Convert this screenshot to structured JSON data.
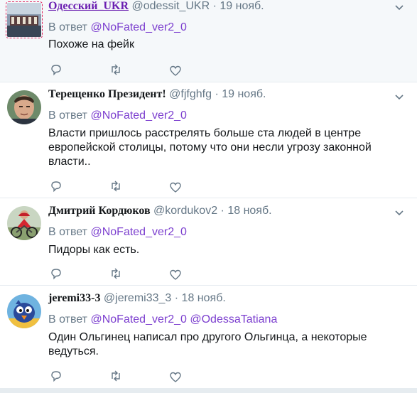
{
  "tweets": [
    {
      "name": "Одесский_UKR",
      "handle": "@odessit_UKR",
      "dot": "·",
      "date": "19 нояб.",
      "reply_prefix": "В ответ",
      "reply_mentions": [
        "@NoFated_ver2_0"
      ],
      "text": "Похоже на фейк",
      "avatar": "odessa-city-avatar"
    },
    {
      "name": "Терещенко Президент!",
      "handle": "@fjfghfg",
      "dot": "·",
      "date": "19 нояб.",
      "reply_prefix": "В ответ",
      "reply_mentions": [
        "@NoFated_ver2_0"
      ],
      "text": "Власти пришлось расстрелять больше ста людей в центре европейской столицы, потому что они несли угрозу законной власти..",
      "avatar": "man-portrait-avatar"
    },
    {
      "name": "Дмитрий Кордюков",
      "handle": "@kordukov2",
      "dot": "·",
      "date": "18 нояб.",
      "reply_prefix": "В ответ",
      "reply_mentions": [
        "@NoFated_ver2_0"
      ],
      "text": "Пидоры как есть.",
      "avatar": "cyclist-avatar"
    },
    {
      "name": "jeremi33-3",
      "handle": "@jeremi33_3",
      "dot": "·",
      "date": "18 нояб.",
      "reply_prefix": "В ответ",
      "reply_mentions": [
        "@NoFated_ver2_0",
        "@OdessaTatiana"
      ],
      "text": "Один Ольгинец написал про другого Ольгинца, а некоторые ведуться.",
      "avatar": "cartoon-bird-avatar"
    }
  ],
  "icons": {
    "reply": "reply-icon",
    "retweet": "retweet-icon",
    "like": "heart-icon",
    "more": "chevron-down-icon"
  },
  "colors": {
    "mention": "#7c3fcf",
    "secondary_text": "#657786",
    "highlight_bg": "#f5f8fa",
    "divider": "#e6ecf0"
  }
}
